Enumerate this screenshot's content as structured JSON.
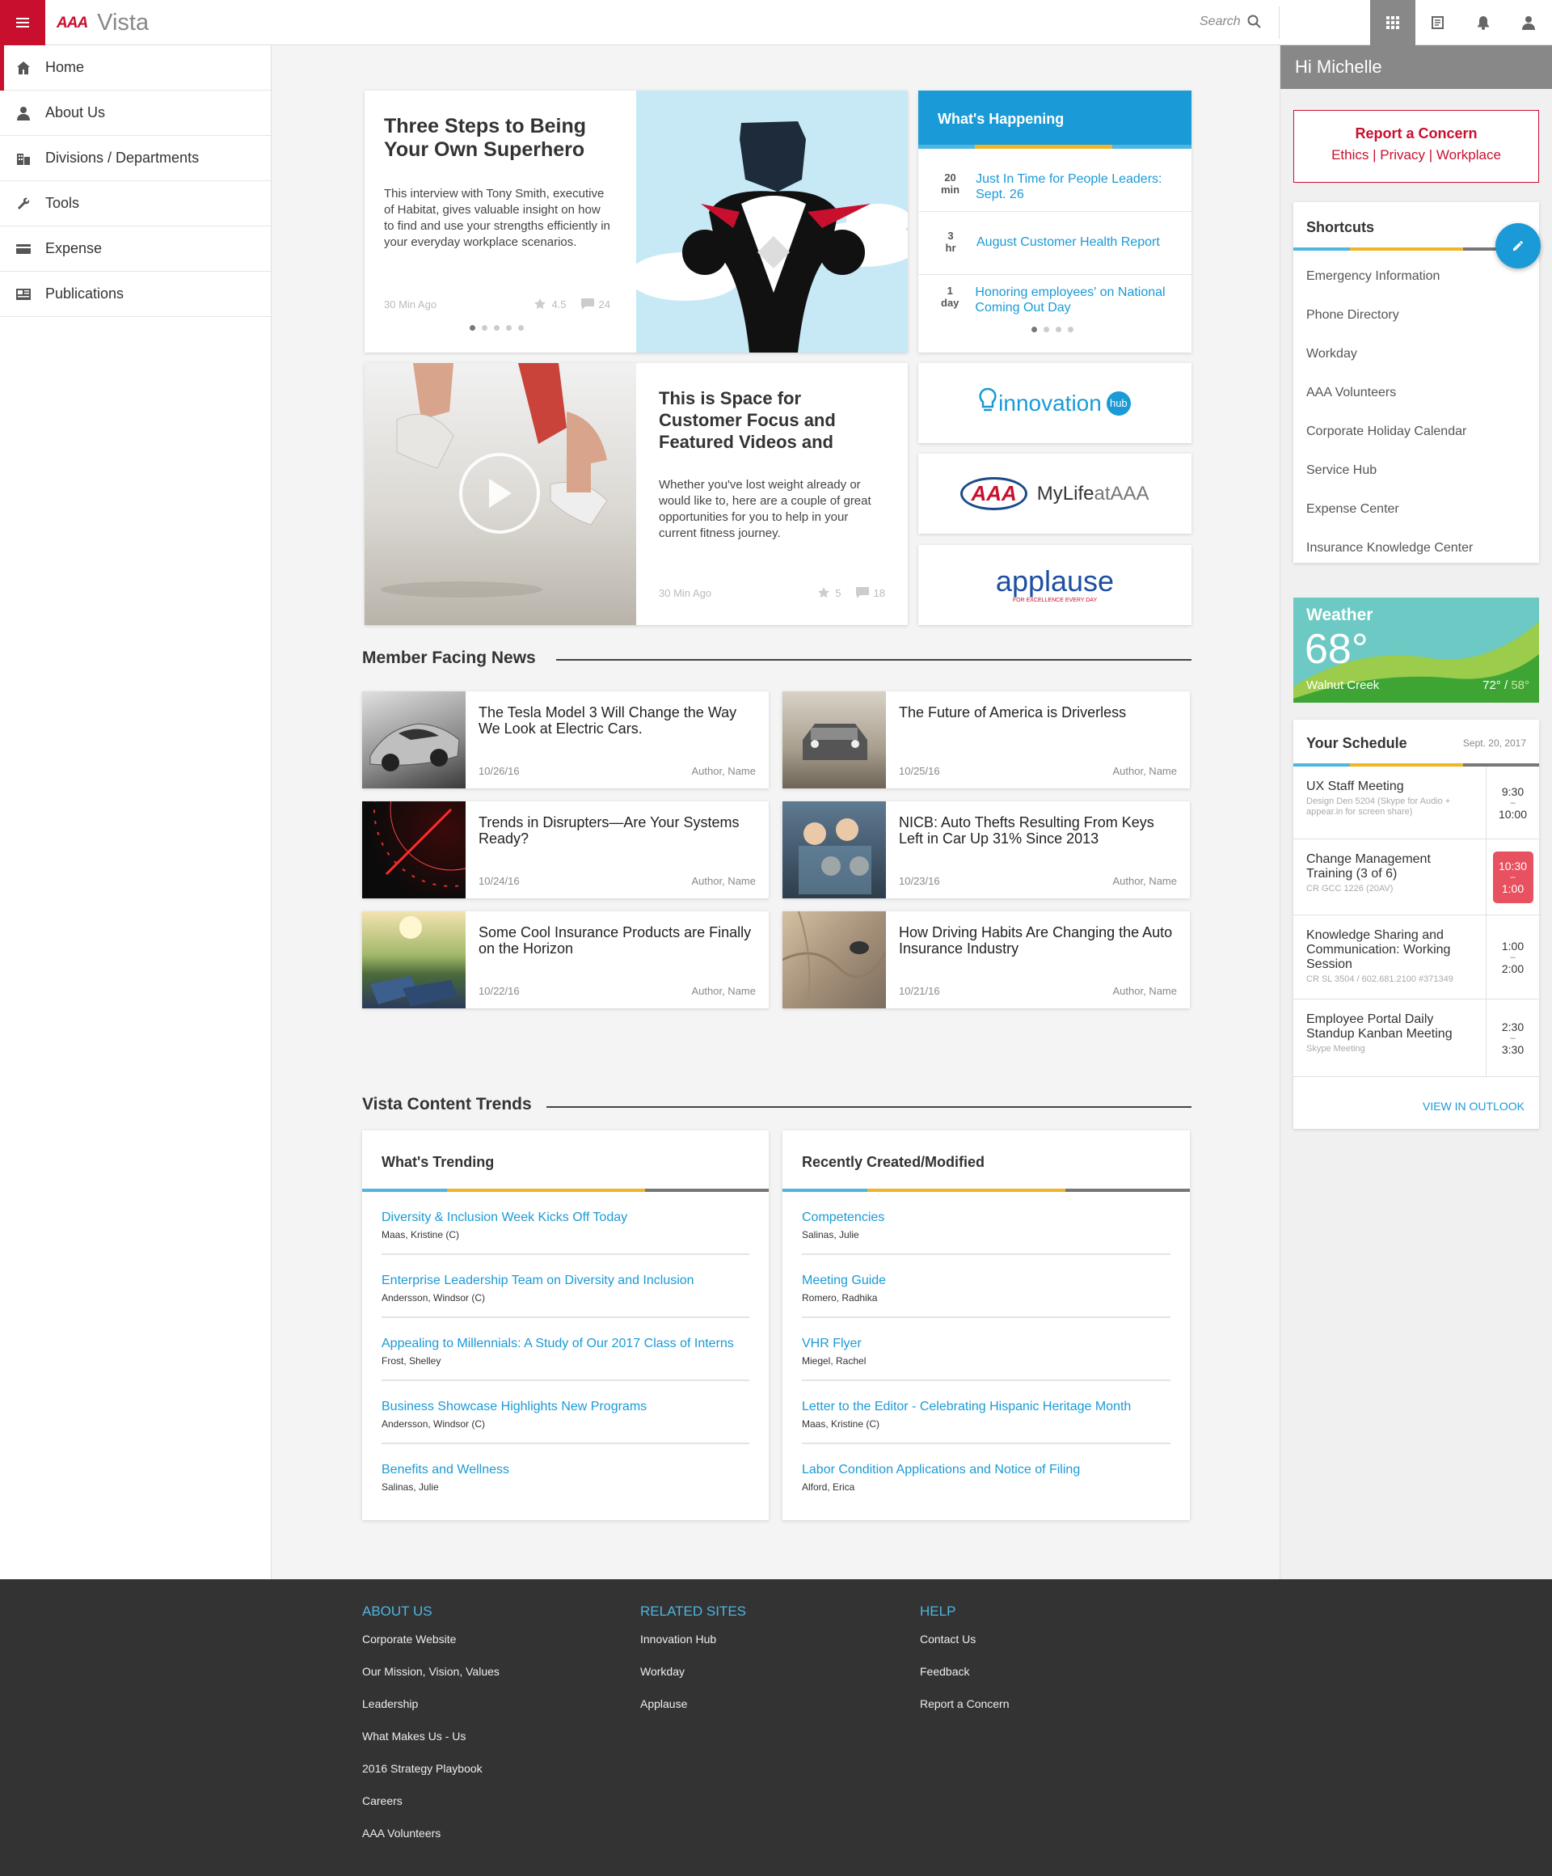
{
  "app": {
    "logo_text": "AAA",
    "brand": "Vista"
  },
  "search": {
    "placeholder": "Search"
  },
  "top_icons": [
    "apps-grid-icon",
    "news-icon",
    "bell-icon",
    "user-icon"
  ],
  "sidebar": {
    "items": [
      {
        "label": "Home",
        "icon": "home-icon",
        "active": true
      },
      {
        "label": "About Us",
        "icon": "person-icon"
      },
      {
        "label": "Divisions / Departments",
        "icon": "building-icon"
      },
      {
        "label": "Tools",
        "icon": "wrench-icon"
      },
      {
        "label": "Expense",
        "icon": "card-icon"
      },
      {
        "label": "Publications",
        "icon": "newspaper-icon"
      }
    ]
  },
  "hero": {
    "title": "Three Steps to Being Your Own Superhero",
    "body": "This interview with Tony Smith, executive of Habitat, gives valuable insight on how to find and use your strengths efficiently in your everyday workplace scenarios.",
    "time": "30 Min Ago",
    "rating": "4.5",
    "comments": "24"
  },
  "whats_happening": {
    "title": "What's Happening",
    "items": [
      {
        "num": "20",
        "unit": "min",
        "text": "Just In Time for People Leaders: Sept. 26"
      },
      {
        "num": "3",
        "unit": "hr",
        "text": "August Customer Health Report"
      },
      {
        "num": "1",
        "unit": "day",
        "text": "Honoring employees' on National Coming Out Day"
      }
    ]
  },
  "video_card": {
    "title": "This is Space for Customer Focus and Featured Videos and",
    "body": "Whether you've lost weight already or would like to, here are a couple of great opportunities for you to help in your current fitness journey.",
    "time": "30 Min Ago",
    "rating": "5",
    "comments": "18"
  },
  "logos": {
    "innovation": {
      "word": "innovation",
      "badge": "hub"
    },
    "mylife": {
      "aaa": "AAA",
      "word_a": "MyLife",
      "word_b": "atAAA"
    },
    "applause": {
      "word": "applause",
      "tagline": "FOR EXCELLENCE EVERY DAY"
    }
  },
  "member_news": {
    "heading": "Member Facing News",
    "items": [
      {
        "title": "The Tesla Model 3 Will Change the Way We Look at Electric Cars.",
        "date": "10/26/16",
        "author": "Author, Name"
      },
      {
        "title": "The Future of America is Driverless",
        "date": "10/25/16",
        "author": "Author, Name"
      },
      {
        "title": "Trends in Disrupters—Are Your Systems Ready?",
        "date": "10/24/16",
        "author": "Author, Name"
      },
      {
        "title": "NICB: Auto Thefts Resulting From Keys Left in Car Up 31% Since 2013",
        "date": "10/23/16",
        "author": "Author, Name"
      },
      {
        "title": "Some Cool Insurance Products are Finally on the Horizon",
        "date": "10/22/16",
        "author": "Author, Name"
      },
      {
        "title": "How Driving Habits Are Changing the Auto Insurance Industry",
        "date": "10/21/16",
        "author": "Author, Name"
      }
    ]
  },
  "content_trends": {
    "heading": "Vista Content Trends",
    "trending": {
      "title": "What's Trending",
      "items": [
        {
          "title": "Diversity & Inclusion Week Kicks Off Today",
          "author": "Maas, Kristine (C)"
        },
        {
          "title": "Enterprise Leadership Team on Diversity and Inclusion",
          "author": "Andersson, Windsor (C)"
        },
        {
          "title": "Appealing to Millennials: A Study of Our 2017 Class of Interns",
          "author": "Frost, Shelley"
        },
        {
          "title": "Business Showcase Highlights New Programs",
          "author": "Andersson, Windsor (C)"
        },
        {
          "title": "Benefits and Wellness",
          "author": "Salinas, Julie"
        }
      ]
    },
    "recent": {
      "title": "Recently Created/Modified",
      "items": [
        {
          "title": "Competencies",
          "author": "Salinas, Julie"
        },
        {
          "title": "Meeting Guide",
          "author": "Romero, Radhika"
        },
        {
          "title": "VHR Flyer",
          "author": "Miegel, Rachel"
        },
        {
          "title": "Letter to the Editor - Celebrating Hispanic Heritage Month",
          "author": "Maas, Kristine (C)"
        },
        {
          "title": "Labor Condition Applications and Notice of Filing",
          "author": "Alford, Erica"
        }
      ]
    }
  },
  "right": {
    "greeting": "Hi Michelle",
    "report": {
      "title": "Report a Concern",
      "link1": "Ethics",
      "sep": "|",
      "link2": "Privacy",
      "link3": "Workplace"
    },
    "shortcuts": {
      "title": "Shortcuts",
      "items": [
        "Emergency Information",
        "Phone Directory",
        "Workday",
        "AAA Volunteers",
        "Corporate Holiday Calendar",
        "Service Hub",
        "Expense Center",
        "Insurance Knowledge Center"
      ]
    },
    "weather": {
      "title": "Weather",
      "temp": "68°",
      "location": "Walnut Creek",
      "high": "72°",
      "sep": "/",
      "low": "58°"
    },
    "schedule": {
      "title": "Your Schedule",
      "date": "Sept. 20, 2017",
      "items": [
        {
          "title": "UX Staff Meeting",
          "sub": "Design Den 5204 (Skype for Audio + appear.in for screen share)",
          "start": "9:30",
          "end": "10:00",
          "highlight": false
        },
        {
          "title": "Change Management Training (3 of 6)",
          "sub": "CR GCC 1226 (20AV)",
          "start": "10:30",
          "end": "1:00",
          "highlight": true
        },
        {
          "title": "Knowledge Sharing and Communication: Working Session",
          "sub": "CR SL 3504 / 602.681.2100 #371349",
          "start": "1:00",
          "end": "2:00",
          "highlight": false
        },
        {
          "title": "Employee Portal Daily Standup Kanban Meeting",
          "sub": "Skype Meeting",
          "start": "2:30",
          "end": "3:30",
          "highlight": false
        }
      ],
      "view_link": "VIEW IN OUTLOOK"
    }
  },
  "footer": {
    "about": {
      "title": "ABOUT US",
      "links": [
        "Corporate Website",
        "Our Mission, Vision, Values",
        "Leadership",
        "What Makes Us - Us",
        "2016 Strategy Playbook",
        "Careers",
        "AAA Volunteers"
      ]
    },
    "related": {
      "title": "RELATED SITES",
      "links": [
        "Innovation Hub",
        "Workday",
        "Applause"
      ]
    },
    "help": {
      "title": "HELP",
      "links": [
        "Contact Us",
        "Feedback",
        "Report a Concern"
      ]
    }
  },
  "colors": {
    "brand_red": "#c8102e",
    "accent_blue": "#1a9ad6",
    "accent_yellow": "#f0b429",
    "highlight_pink": "#e8515f",
    "footer_bg": "#333333"
  }
}
